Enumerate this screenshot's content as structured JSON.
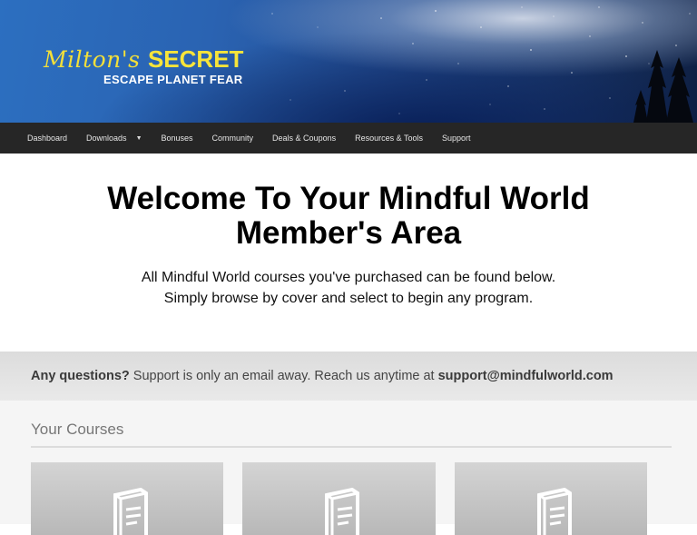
{
  "header": {
    "logo_script": "Milton's",
    "logo_secret": "SECRET",
    "logo_subtitle": "ESCAPE PLANET FEAR"
  },
  "nav": {
    "items": [
      "Dashboard",
      "Downloads",
      "Bonuses",
      "Community",
      "Deals & Coupons",
      "Resources & Tools",
      "Support"
    ]
  },
  "hero": {
    "title_line1": "Welcome To Your Mindful World",
    "title_line2": "Member's Area",
    "subtitle_line1": "All Mindful World courses you've purchased can be found below.",
    "subtitle_line2": "Simply browse by cover and select to begin any program."
  },
  "support": {
    "lead": "Any questions?",
    "text": " Support is only an email away. Reach us anytime at ",
    "email": "support@mindfulworld.com"
  },
  "courses": {
    "title": "Your Courses",
    "cards": [
      "book-icon",
      "book-icon",
      "book-icon"
    ]
  },
  "colors": {
    "logo_yellow": "#f2df3a",
    "nav_bg": "#262626",
    "support_bg": "#e3e3e3"
  }
}
